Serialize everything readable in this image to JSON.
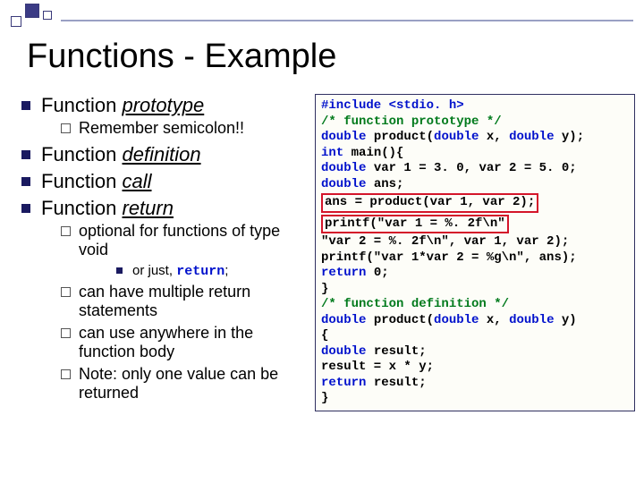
{
  "title": "Functions - Example",
  "bullets": {
    "b1": "Function ",
    "b1u": "prototype",
    "b1s1": "Remember semicolon!!",
    "b2": "Function ",
    "b2u": "definition",
    "b3": "Function ",
    "b3u": "call",
    "b4": "Function ",
    "b4u": "return",
    "b4s1": "optional for functions of type void",
    "b4s1a": "or just, ",
    "b4s1a_kw": "return",
    "b4s1a_tail": ";",
    "b4s2": "can have multiple return statements",
    "b4s3": "can use anywhere in the function body",
    "b4s4": "Note: only one value can be returned"
  },
  "code": {
    "l1a": "#include ",
    "l1b": "<stdio. h>",
    "l2": "/* function prototype */",
    "l3a": "double",
    "l3b": " product(",
    "l3c": "double",
    "l3d": " x, ",
    "l3e": "double",
    "l3f": " y);",
    "blank1": " ",
    "l4a": "int",
    "l4b": " main(){",
    "l5a": "   double",
    "l5b": " var 1 = 3. 0, var 2 = 5. 0;",
    "l6a": "   double",
    "l6b": " ans;",
    "l7": "   ans = product(var 1, var 2);",
    "l8": "   printf(\"var 1 = %. 2f\\n\"",
    "l9": "          \"var 2 = %. 2f\\n\", var 1, var 2);",
    "l10": "   printf(\"var 1*var 2 = %g\\n\", ans);",
    "l11a": "   return",
    "l11b": " 0;",
    "l12": "}",
    "l13": "/* function definition */",
    "l14a": "double",
    "l14b": " product(",
    "l14c": "double",
    "l14d": " x, ",
    "l14e": "double",
    "l14f": " y)",
    "l15": " {",
    "l16a": "   double",
    "l16b": " result;",
    "l17": "   result = x * y;",
    "l18a": "   return",
    "l18b": " result;",
    "l19": " }"
  }
}
